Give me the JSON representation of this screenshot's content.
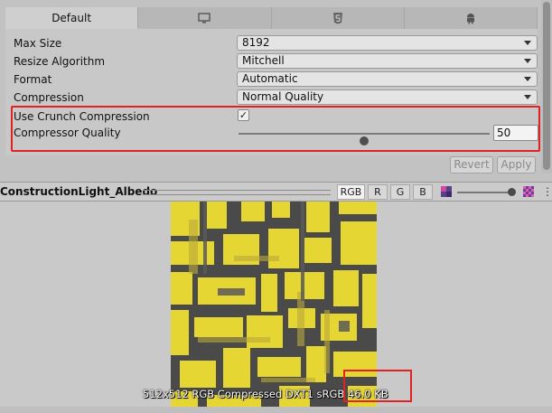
{
  "tabs": [
    {
      "label": "Default",
      "icon": ""
    },
    {
      "label": "",
      "icon": "monitor-icon"
    },
    {
      "label": "",
      "icon": "html5-icon"
    },
    {
      "label": "",
      "icon": "android-icon"
    }
  ],
  "settings": {
    "max_size": {
      "label": "Max Size",
      "value": "8192"
    },
    "resize_algorithm": {
      "label": "Resize Algorithm",
      "value": "Mitchell"
    },
    "format": {
      "label": "Format",
      "value": "Automatic"
    },
    "compression": {
      "label": "Compression",
      "value": "Normal Quality"
    },
    "use_crunch": {
      "label": "Use Crunch Compression",
      "checked": true,
      "check_glyph": "✓"
    },
    "compressor_quality": {
      "label": "Compressor Quality",
      "value": "50",
      "min": 0,
      "max": 100
    }
  },
  "buttons": {
    "revert": "Revert",
    "apply": "Apply"
  },
  "preview": {
    "title": "ConstructionLight_Albedo",
    "channels": [
      "RGB",
      "R",
      "G",
      "B"
    ],
    "active_channel": "RGB",
    "caption": "512x512  RGB Compressed DXT1 sRGB  46.0 KB",
    "kebab": "⋮"
  },
  "colors": {
    "highlight": "#e02222",
    "texture_yellow": "#e8d832",
    "texture_dark": "#4a4a4a"
  }
}
